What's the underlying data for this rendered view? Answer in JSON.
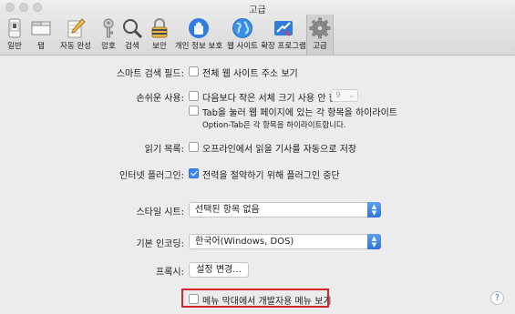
{
  "window": {
    "title": "고급"
  },
  "toolbar": {
    "items": [
      {
        "label": "일반",
        "icon": "phone-switch-icon"
      },
      {
        "label": "탭",
        "icon": "tabs-icon"
      },
      {
        "label": "자동 완성",
        "icon": "pencil-form-icon"
      },
      {
        "label": "암호",
        "icon": "key-icon"
      },
      {
        "label": "검색",
        "icon": "magnifier-icon"
      },
      {
        "label": "보안",
        "icon": "lock-icon"
      },
      {
        "label": "개인 정보 보호",
        "icon": "privacy-hand-icon"
      },
      {
        "label": "웹 사이트",
        "icon": "globe-icon"
      },
      {
        "label": "확장 프로그램",
        "icon": "puzzle-icon"
      },
      {
        "label": "고급",
        "icon": "gear-icon"
      }
    ],
    "selected": "고급"
  },
  "settings": {
    "smart_search": {
      "label": "스마트 검색 필드:",
      "option": "전체 웹 사이트 주소 보기",
      "checked": false
    },
    "accessibility": {
      "label": "손쉬운 사용:",
      "option1": "다음보다 작은 서체 크기 사용 안 함",
      "font_size": "9",
      "option2": "Tab을 눌러 웹 페이지에 있는 각 항목을 하이라이트",
      "note": "Option-Tab은 각 항목을 하이라이트합니다."
    },
    "reading_list": {
      "label": "읽기 목록:",
      "option": "오프라인에서 읽을 기사를 자동으로 저장"
    },
    "plugins": {
      "label": "인터넷 플러그인:",
      "option": "전력을 절약하기 위해 플러그인 중단",
      "checked": true
    },
    "style_sheet": {
      "label": "스타일 시트:",
      "value": "선택된 항목 없음"
    },
    "encoding": {
      "label": "기본 인코딩:",
      "value": "한국어(Windows, DOS)"
    },
    "proxy": {
      "label": "프록시:",
      "button": "설정 변경..."
    },
    "develop_menu": {
      "option": "메뉴 막대에서 개발자용 메뉴 보기",
      "checked": false
    }
  },
  "help": {
    "glyph": "?"
  },
  "colors": {
    "accent": "#3b86f7",
    "highlight_border": "#d4262b"
  }
}
